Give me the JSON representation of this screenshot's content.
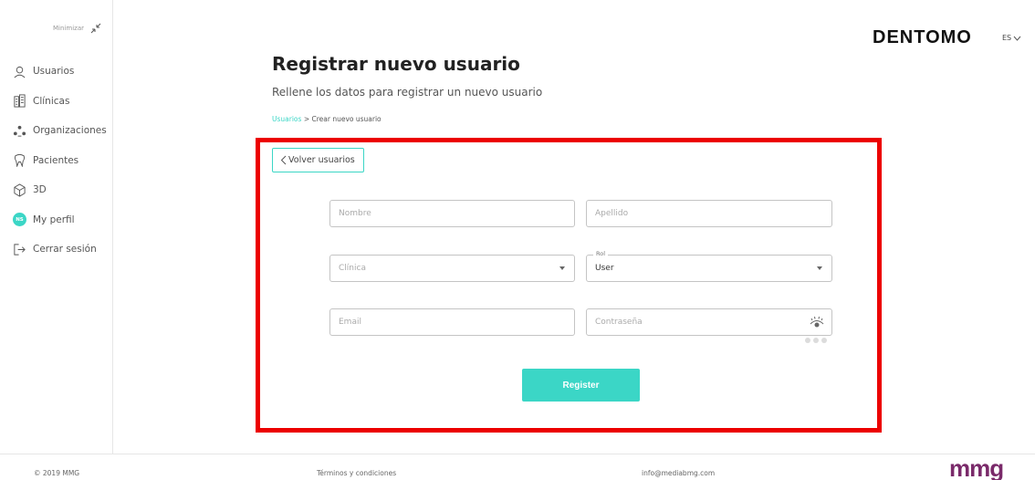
{
  "sidebar": {
    "minimize_label": "Minimizar",
    "items": [
      {
        "label": "Usuarios",
        "icon": "user-icon"
      },
      {
        "label": "Clínicas",
        "icon": "building-icon"
      },
      {
        "label": "Organizaciones",
        "icon": "organization-icon"
      },
      {
        "label": "Pacientes",
        "icon": "tooth-icon"
      },
      {
        "label": "3D",
        "icon": "cube-icon"
      },
      {
        "label": "My perfil",
        "icon": "avatar",
        "avatar_initials": "NS"
      },
      {
        "label": "Cerrar sesión",
        "icon": "logout-icon"
      }
    ]
  },
  "header": {
    "logo": "DENTOMO",
    "language": "ES"
  },
  "main": {
    "title": "Registrar nuevo usuario",
    "subtitle": "Rellene los datos para registrar un nuevo usuario",
    "breadcrumb": {
      "link": "Usuarios",
      "separator": ">",
      "current": "Crear nuevo usuario"
    },
    "back_button": "Volver usuarios",
    "form": {
      "nombre_placeholder": "Nombre",
      "apellido_placeholder": "Apellido",
      "clinica_placeholder": "Clínica",
      "rol_label": "Rol",
      "rol_value": "User",
      "email_placeholder": "Email",
      "password_placeholder": "Contraseña",
      "register_label": "Register"
    }
  },
  "footer": {
    "copyright": "© 2019 MMG",
    "terms": "Términos y condiciones",
    "email": "info@mediabmg.com",
    "brand": "mmg"
  },
  "colors": {
    "accent": "#3bd6c6",
    "highlight_frame": "#ec0000",
    "brand_mmg": "#7a2a6a"
  }
}
